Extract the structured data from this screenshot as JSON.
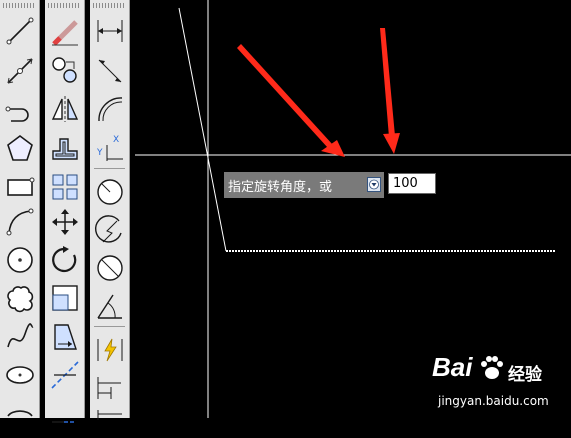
{
  "toolbar": {
    "draw": [
      "line",
      "construction-line",
      "polyline",
      "polygon",
      "rectangle",
      "arc",
      "circle",
      "revision-cloud",
      "spline",
      "ellipse",
      "ellipse-arc"
    ],
    "modify": [
      "erase",
      "copy",
      "mirror",
      "offset",
      "array",
      "move",
      "rotate",
      "scale",
      "stretch",
      "trim",
      "extend"
    ],
    "dimension": [
      "linear-dimension",
      "aligned-dimension",
      "arc-length",
      "ordinate",
      "radius",
      "jogged",
      "diameter",
      "angular",
      "quick-dimension",
      "baseline",
      "continue"
    ]
  },
  "command": {
    "prompt": "指定旋转角度，或",
    "options_icon": "down-arrow-icon",
    "input_value": "100"
  },
  "watermark": {
    "brand": "Bai",
    "brand_tail": "经验",
    "url": "jingyan.baidu.com"
  },
  "colors": {
    "canvas": "#000000",
    "crosshair": "#ffffff",
    "annotation_arrow": "#ff2a1a",
    "prompt_bg": "#7a7a7a"
  }
}
